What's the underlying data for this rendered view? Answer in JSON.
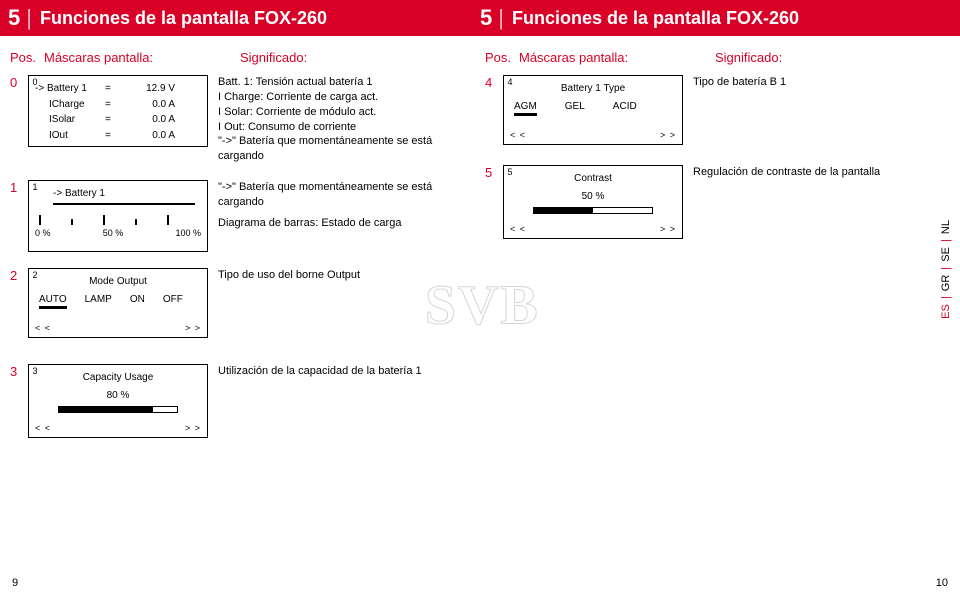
{
  "header": {
    "left_num": "5",
    "left_title": "Funciones de la pantalla FOX-260",
    "right_num": "5",
    "right_title": "Funciones de la pantalla FOX-260"
  },
  "cols": {
    "pos": "Pos.",
    "mask": "Máscaras pantalla:",
    "sig": "Significado:"
  },
  "left": {
    "r0": {
      "pos": "0",
      "badge": "0",
      "l1k": "-> Battery 1",
      "l1e": "=",
      "l1v": "12.9 V",
      "l2k": "ICharge",
      "l2e": "=",
      "l2v": "0.0 A",
      "l3k": "ISolar",
      "l3e": "=",
      "l3v": "0.0 A",
      "l4k": "IOut",
      "l4e": "=",
      "l4v": "0.0 A",
      "s1": "Batt. 1: Tensión actual batería 1",
      "s2": "I Charge: Corriente de carga act.",
      "s3": "I Solar: Corriente de módulo act.",
      "s4": "I Out: Consumo de corriente",
      "s5": "\"->\" Batería que momentáneamente se está cargando"
    },
    "r1": {
      "pos": "1",
      "badge": "1",
      "title": "-> Battery 1",
      "p0": "0 %",
      "p50": "50 %",
      "p100": "100 %",
      "s1": "\"->\" Batería que momentáneamente se está cargando",
      "s2": "Diagrama de barras: Estado de carga"
    },
    "r2": {
      "pos": "2",
      "badge": "2",
      "title": "Mode Output",
      "o1": "AUTO",
      "o2": "LAMP",
      "o3": "ON",
      "o4": "OFF",
      "navL": "< <",
      "navR": "> >",
      "sig": "Tipo de uso del borne Output"
    },
    "r3": {
      "pos": "3",
      "badge": "3",
      "title": "Capacity Usage",
      "val": "80 %",
      "navL": "< <",
      "navR": "> >",
      "sig": "Utilización de la capacidad de la batería 1"
    }
  },
  "right": {
    "r4": {
      "pos": "4",
      "badge": "4",
      "title": "Battery 1 Type",
      "o1": "AGM",
      "o2": "GEL",
      "o3": "ACID",
      "navL": "< <",
      "navR": "> >",
      "sig": "Tipo de batería B 1"
    },
    "r5": {
      "pos": "5",
      "badge": "5",
      "title": "Contrast",
      "val": "50 %",
      "navL": "< <",
      "navR": "> >",
      "sig": "Regulación de contraste de la pantalla"
    }
  },
  "watermark": "SVB",
  "langs": {
    "es": "ES",
    "gr": "GR",
    "se": "SE",
    "nl": "NL"
  },
  "footer": {
    "left": "9",
    "right": "10"
  }
}
